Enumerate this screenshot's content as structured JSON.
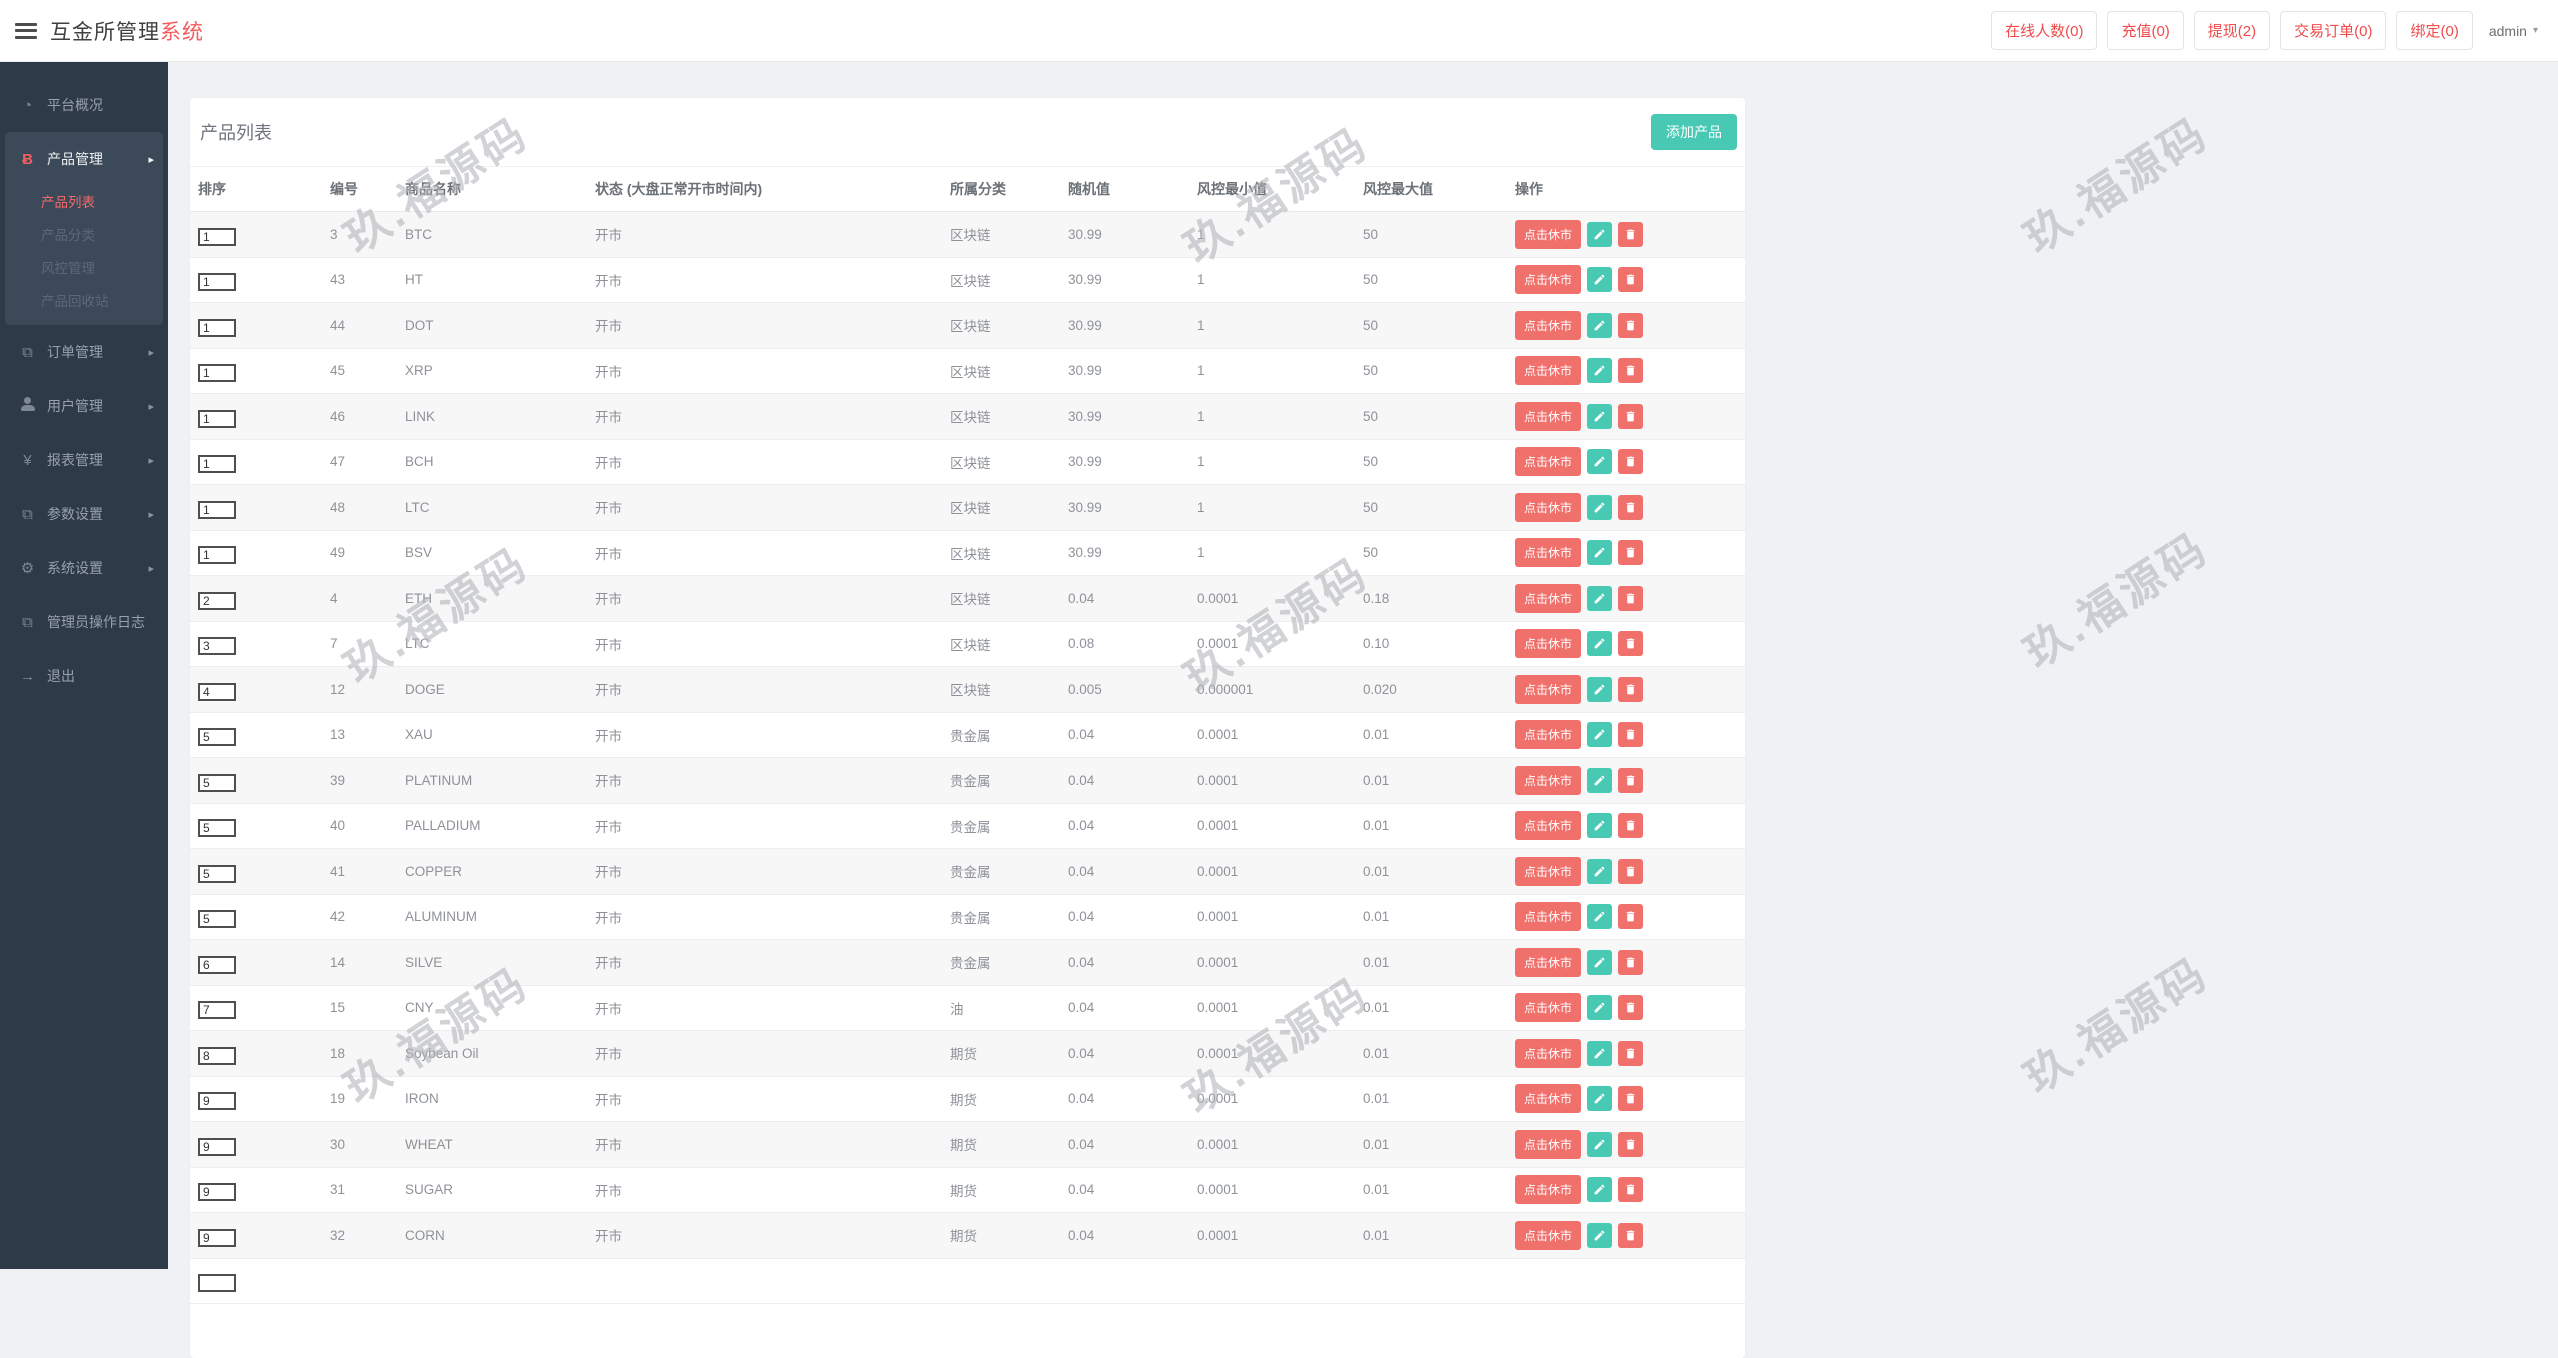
{
  "app": {
    "title_primary": "互金所管理",
    "title_accent": "系统"
  },
  "header": {
    "nav_items": [
      {
        "label": "在线人数(0)"
      },
      {
        "label": "充值(0)"
      },
      {
        "label": "提现(2)"
      },
      {
        "label": "交易订单(0)"
      },
      {
        "label": "绑定(0)"
      }
    ],
    "admin_label": "admin"
  },
  "sidebar": {
    "items": [
      {
        "label": "平台概况",
        "icon": "dashboard-icon",
        "glyph": "◔",
        "chevron": false,
        "type": "top"
      },
      {
        "label": "产品管理",
        "icon": "bitcoin-icon",
        "glyph": "Ƀ",
        "chevron": true,
        "type": "group"
      },
      {
        "label": "产品列表",
        "type": "sub",
        "active": true
      },
      {
        "label": "产品分类",
        "type": "sub",
        "active": false
      },
      {
        "label": "风控管理",
        "type": "sub",
        "active": false
      },
      {
        "label": "产品回收站",
        "type": "sub",
        "active": false
      },
      {
        "label": "订单管理",
        "icon": "files-icon",
        "glyph": "⧉",
        "chevron": true,
        "type": "top"
      },
      {
        "label": "用户管理",
        "icon": "user-icon",
        "glyph": "",
        "chevron": true,
        "type": "top"
      },
      {
        "label": "报表管理",
        "icon": "yen-icon",
        "glyph": "¥",
        "chevron": true,
        "type": "top"
      },
      {
        "label": "参数设置",
        "icon": "files-icon",
        "glyph": "⧉",
        "chevron": true,
        "type": "top"
      },
      {
        "label": "系统设置",
        "icon": "gear-icon",
        "glyph": "⚙",
        "chevron": true,
        "type": "top"
      },
      {
        "label": "管理员操作日志",
        "icon": "log-icon",
        "glyph": "⧉",
        "chevron": false,
        "type": "top"
      },
      {
        "label": "退出",
        "icon": "logout-icon",
        "glyph": "→",
        "chevron": false,
        "type": "top"
      }
    ]
  },
  "main": {
    "card_title": "产品列表",
    "add_button_label": "添加产品",
    "table": {
      "columns": [
        "排序",
        "编号",
        "商品名称",
        "状态 (大盘正常开市时间内)",
        "所属分类",
        "随机值",
        "风控最小值",
        "风控最大值",
        "操作"
      ],
      "action_labels": {
        "suspend": "点击休市",
        "edit": "edit-pencil-icon",
        "delete": "delete-trash-icon"
      },
      "rows": [
        {
          "sort": "1",
          "id": "3",
          "name": "BTC",
          "status": "开市",
          "category": "区块链",
          "random": "30.99",
          "min": "1",
          "max": "50"
        },
        {
          "sort": "1",
          "id": "43",
          "name": "HT",
          "status": "开市",
          "category": "区块链",
          "random": "30.99",
          "min": "1",
          "max": "50"
        },
        {
          "sort": "1",
          "id": "44",
          "name": "DOT",
          "status": "开市",
          "category": "区块链",
          "random": "30.99",
          "min": "1",
          "max": "50"
        },
        {
          "sort": "1",
          "id": "45",
          "name": "XRP",
          "status": "开市",
          "category": "区块链",
          "random": "30.99",
          "min": "1",
          "max": "50"
        },
        {
          "sort": "1",
          "id": "46",
          "name": "LINK",
          "status": "开市",
          "category": "区块链",
          "random": "30.99",
          "min": "1",
          "max": "50"
        },
        {
          "sort": "1",
          "id": "47",
          "name": "BCH",
          "status": "开市",
          "category": "区块链",
          "random": "30.99",
          "min": "1",
          "max": "50"
        },
        {
          "sort": "1",
          "id": "48",
          "name": "LTC",
          "status": "开市",
          "category": "区块链",
          "random": "30.99",
          "min": "1",
          "max": "50"
        },
        {
          "sort": "1",
          "id": "49",
          "name": "BSV",
          "status": "开市",
          "category": "区块链",
          "random": "30.99",
          "min": "1",
          "max": "50"
        },
        {
          "sort": "2",
          "id": "4",
          "name": "ETH",
          "status": "开市",
          "category": "区块链",
          "random": "0.04",
          "min": "0.0001",
          "max": "0.18"
        },
        {
          "sort": "3",
          "id": "7",
          "name": "LTC",
          "status": "开市",
          "category": "区块链",
          "random": "0.08",
          "min": "0.0001",
          "max": "0.10"
        },
        {
          "sort": "4",
          "id": "12",
          "name": "DOGE",
          "status": "开市",
          "category": "区块链",
          "random": "0.005",
          "min": "0.000001",
          "max": "0.020"
        },
        {
          "sort": "5",
          "id": "13",
          "name": "XAU",
          "status": "开市",
          "category": "贵金属",
          "random": "0.04",
          "min": "0.0001",
          "max": "0.01"
        },
        {
          "sort": "5",
          "id": "39",
          "name": "PLATINUM",
          "status": "开市",
          "category": "贵金属",
          "random": "0.04",
          "min": "0.0001",
          "max": "0.01"
        },
        {
          "sort": "5",
          "id": "40",
          "name": "PALLADIUM",
          "status": "开市",
          "category": "贵金属",
          "random": "0.04",
          "min": "0.0001",
          "max": "0.01"
        },
        {
          "sort": "5",
          "id": "41",
          "name": "COPPER",
          "status": "开市",
          "category": "贵金属",
          "random": "0.04",
          "min": "0.0001",
          "max": "0.01"
        },
        {
          "sort": "5",
          "id": "42",
          "name": "ALUMINUM",
          "status": "开市",
          "category": "贵金属",
          "random": "0.04",
          "min": "0.0001",
          "max": "0.01"
        },
        {
          "sort": "6",
          "id": "14",
          "name": "SILVE",
          "status": "开市",
          "category": "贵金属",
          "random": "0.04",
          "min": "0.0001",
          "max": "0.01"
        },
        {
          "sort": "7",
          "id": "15",
          "name": "CNY",
          "status": "开市",
          "category": "油",
          "random": "0.04",
          "min": "0.0001",
          "max": "0.01"
        },
        {
          "sort": "8",
          "id": "18",
          "name": "Soybean Oil",
          "status": "开市",
          "category": "期货",
          "random": "0.04",
          "min": "0.0001",
          "max": "0.01"
        },
        {
          "sort": "9",
          "id": "19",
          "name": "IRON",
          "status": "开市",
          "category": "期货",
          "random": "0.04",
          "min": "0.0001",
          "max": "0.01"
        },
        {
          "sort": "9",
          "id": "30",
          "name": "WHEAT",
          "status": "开市",
          "category": "期货",
          "random": "0.04",
          "min": "0.0001",
          "max": "0.01"
        },
        {
          "sort": "9",
          "id": "31",
          "name": "SUGAR",
          "status": "开市",
          "category": "期货",
          "random": "0.04",
          "min": "0.0001",
          "max": "0.01"
        },
        {
          "sort": "9",
          "id": "32",
          "name": "CORN",
          "status": "开市",
          "category": "期货",
          "random": "0.04",
          "min": "0.0001",
          "max": "0.01"
        }
      ],
      "partial_row": {
        "sort": ""
      }
    }
  },
  "watermark": {
    "text": "玖.福源码"
  },
  "colors": {
    "accent_teal": "#47c9b4",
    "accent_red": "#f0716b",
    "header_link_red": "#f04b4b",
    "sidebar_bg": "#2e3a48",
    "sidebar_group_bg": "#3c4959",
    "active_menu_red": "#f16a6a",
    "stripe": "#f7f7f8",
    "main_bg": "#eff1f5"
  }
}
